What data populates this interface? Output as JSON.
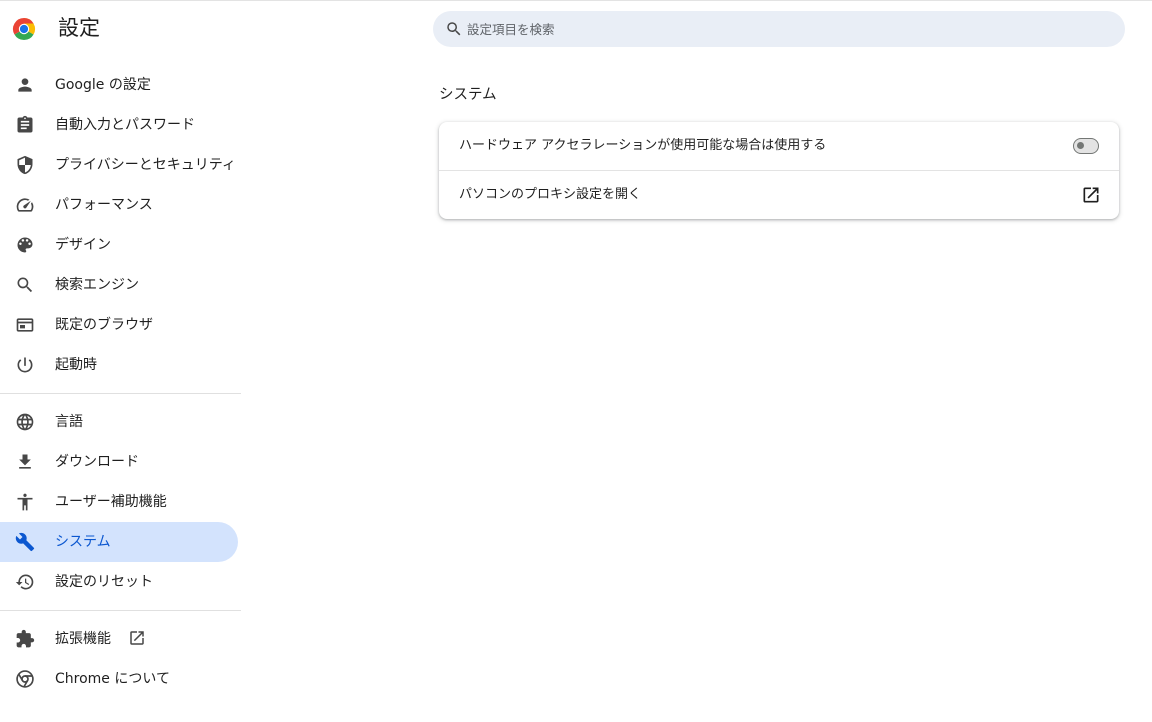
{
  "app": {
    "title": "設定"
  },
  "search": {
    "placeholder": "設定項目を検索",
    "value": ""
  },
  "sidebar": {
    "items": [
      {
        "label": "Google の設定",
        "icon": "person-icon"
      },
      {
        "label": "自動入力とパスワード",
        "icon": "clipboard-icon"
      },
      {
        "label": "プライバシーとセキュリティ",
        "icon": "shield-icon"
      },
      {
        "label": "パフォーマンス",
        "icon": "speedometer-icon"
      },
      {
        "label": "デザイン",
        "icon": "palette-icon"
      },
      {
        "label": "検索エンジン",
        "icon": "search-icon"
      },
      {
        "label": "既定のブラウザ",
        "icon": "browser-window-icon"
      },
      {
        "label": "起動時",
        "icon": "power-icon"
      },
      {
        "label": "言語",
        "icon": "globe-icon"
      },
      {
        "label": "ダウンロード",
        "icon": "download-icon"
      },
      {
        "label": "ユーザー補助機能",
        "icon": "accessibility-icon"
      },
      {
        "label": "システム",
        "icon": "wrench-icon",
        "selected": true
      },
      {
        "label": "設定のリセット",
        "icon": "restore-icon"
      },
      {
        "label": "拡張機能",
        "icon": "puzzle-icon",
        "external_icon": "open-in-new-icon"
      },
      {
        "label": "Chrome について",
        "icon": "chrome-icon"
      }
    ]
  },
  "main": {
    "section_title": "システム",
    "rows": [
      {
        "label": "ハードウェア アクセラレーションが使用可能な場合は使用する",
        "control": "toggle",
        "enabled": false
      },
      {
        "label": "パソコンのプロキシ設定を開く",
        "control": "open-in-new-icon"
      }
    ]
  },
  "colors": {
    "accent": "#0b57d0",
    "selected_bg": "#d3e3fd",
    "search_bg": "#e9eef6",
    "icon": "#474747",
    "text": "#1f1f1f"
  }
}
